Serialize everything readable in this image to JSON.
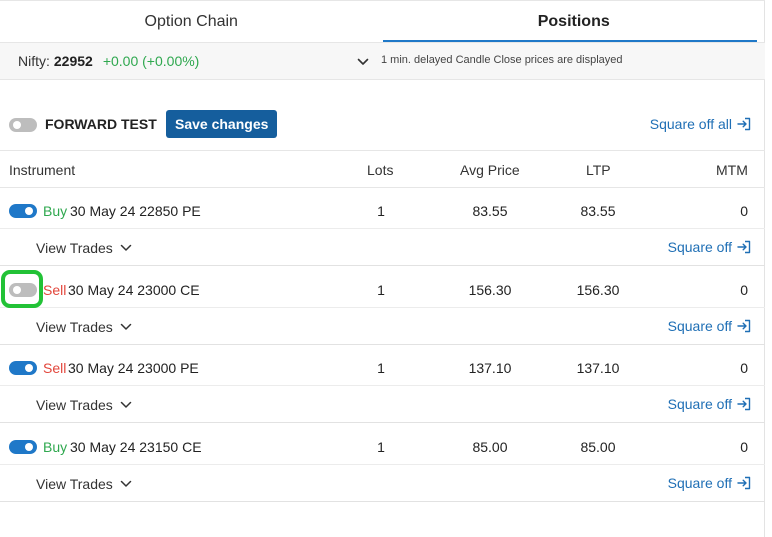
{
  "tabs": [
    {
      "label": "Option Chain",
      "active": false
    },
    {
      "label": "Positions",
      "active": true
    }
  ],
  "info": {
    "nifty_label": "Nifty:",
    "nifty_value": "22952",
    "nifty_change": "+0.00 (+0.00%)",
    "delay_note": "1 min. delayed Candle Close prices are displayed"
  },
  "controls": {
    "forward_test_label": "FORWARD TEST",
    "forward_test_on": false,
    "save_label": "Save changes",
    "square_off_all_label": "Square off all"
  },
  "columns": {
    "instrument": "Instrument",
    "lots": "Lots",
    "avg_price": "Avg Price",
    "ltp": "LTP",
    "mtm": "MTM"
  },
  "positions": [
    {
      "enabled": true,
      "side": "Buy",
      "instrument": "30 May 24 22850 PE",
      "lots": "1",
      "avg_price": "83.55",
      "ltp": "83.55",
      "mtm": "0",
      "view_trades": "View Trades",
      "square_off": "Square off"
    },
    {
      "enabled": false,
      "side": "Sell",
      "instrument": "30 May 24 23000 CE",
      "lots": "1",
      "avg_price": "156.30",
      "ltp": "156.30",
      "mtm": "0",
      "view_trades": "View Trades",
      "square_off": "Square off"
    },
    {
      "enabled": true,
      "side": "Sell",
      "instrument": "30 May 24 23000 PE",
      "lots": "1",
      "avg_price": "137.10",
      "ltp": "137.10",
      "mtm": "0",
      "view_trades": "View Trades",
      "square_off": "Square off"
    },
    {
      "enabled": true,
      "side": "Buy",
      "instrument": "30 May 24 23150 CE",
      "lots": "1",
      "avg_price": "85.00",
      "ltp": "85.00",
      "mtm": "0",
      "view_trades": "View Trades",
      "square_off": "Square off"
    }
  ],
  "colors": {
    "accent": "#1f78c8",
    "save_button": "#155e9d",
    "buy": "#2fa84f",
    "sell": "#e2463b",
    "highlight": "#22c236"
  },
  "icons": {
    "chevron": "chevron-down-icon",
    "square_off": "exit-icon"
  }
}
